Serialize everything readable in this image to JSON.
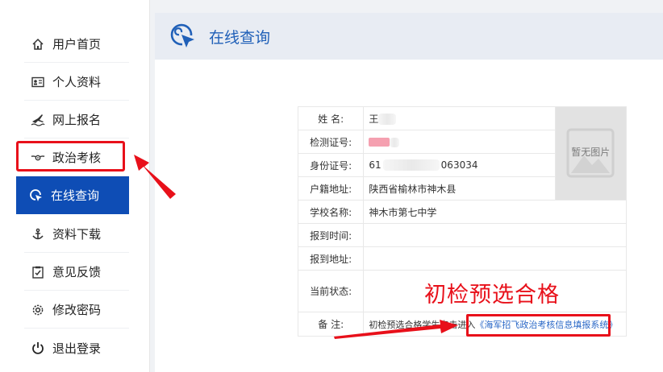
{
  "sidebar": {
    "items": [
      {
        "label": "用户首页",
        "icon": "home-icon"
      },
      {
        "label": "个人资料",
        "icon": "id-card-icon"
      },
      {
        "label": "网上报名",
        "icon": "plane-icon"
      },
      {
        "label": "政治考核",
        "icon": "wings-badge-icon"
      },
      {
        "label": "在线查询",
        "icon": "search-cursor-icon"
      },
      {
        "label": "资料下载",
        "icon": "anchor-icon"
      },
      {
        "label": "意见反馈",
        "icon": "clipboard-check-icon"
      },
      {
        "label": "修改密码",
        "icon": "gear-icon"
      },
      {
        "label": "退出登录",
        "icon": "power-icon"
      }
    ],
    "active_index": 4
  },
  "header": {
    "title": "在线查询"
  },
  "info": {
    "name_label": "姓 名:",
    "name_value": "王",
    "exam_id_label": "检测证号:",
    "id_label": "身份证号:",
    "id_prefix": "61",
    "id_suffix": "063034",
    "household_label": "户籍地址:",
    "household_value": "陕西省榆林市神木县",
    "school_label": "学校名称:",
    "school_value": "神木市第七中学",
    "report_time_label": "报到时间:",
    "report_time_value": "",
    "report_addr_label": "报到地址:",
    "report_addr_value": "",
    "status_label": "当前状态:",
    "status_value": "初检预选合格",
    "remark_label": "备 注:",
    "remark_text": "初检预选合格学生点击进入",
    "remark_link": "《海军招飞政治考核信息填报系统》",
    "photo_placeholder": "暂无图片"
  },
  "colors": {
    "accent": "#0e4db5",
    "highlight": "#e8101a",
    "header_bg": "#e8ecf3",
    "link": "#2a68c7"
  }
}
